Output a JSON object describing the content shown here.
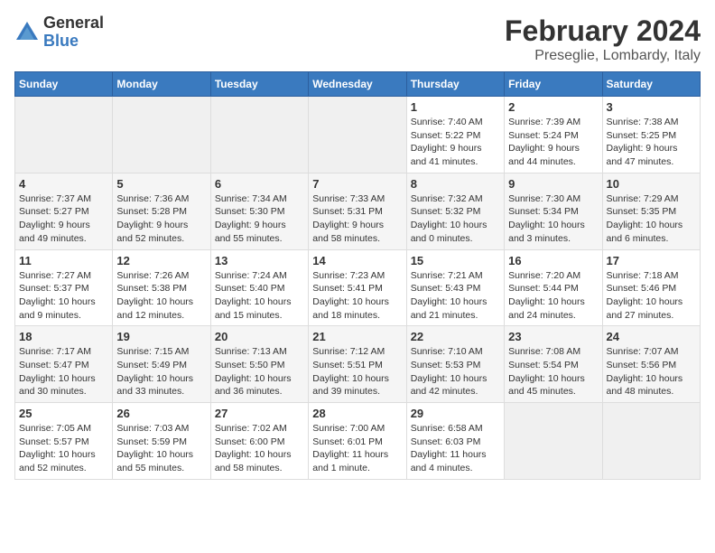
{
  "header": {
    "logo_line1": "General",
    "logo_line2": "Blue",
    "title": "February 2024",
    "subtitle": "Preseglie, Lombardy, Italy"
  },
  "days_of_week": [
    "Sunday",
    "Monday",
    "Tuesday",
    "Wednesday",
    "Thursday",
    "Friday",
    "Saturday"
  ],
  "weeks": [
    [
      {
        "day": "",
        "info": ""
      },
      {
        "day": "",
        "info": ""
      },
      {
        "day": "",
        "info": ""
      },
      {
        "day": "",
        "info": ""
      },
      {
        "day": "1",
        "info": "Sunrise: 7:40 AM\nSunset: 5:22 PM\nDaylight: 9 hours\nand 41 minutes."
      },
      {
        "day": "2",
        "info": "Sunrise: 7:39 AM\nSunset: 5:24 PM\nDaylight: 9 hours\nand 44 minutes."
      },
      {
        "day": "3",
        "info": "Sunrise: 7:38 AM\nSunset: 5:25 PM\nDaylight: 9 hours\nand 47 minutes."
      }
    ],
    [
      {
        "day": "4",
        "info": "Sunrise: 7:37 AM\nSunset: 5:27 PM\nDaylight: 9 hours\nand 49 minutes."
      },
      {
        "day": "5",
        "info": "Sunrise: 7:36 AM\nSunset: 5:28 PM\nDaylight: 9 hours\nand 52 minutes."
      },
      {
        "day": "6",
        "info": "Sunrise: 7:34 AM\nSunset: 5:30 PM\nDaylight: 9 hours\nand 55 minutes."
      },
      {
        "day": "7",
        "info": "Sunrise: 7:33 AM\nSunset: 5:31 PM\nDaylight: 9 hours\nand 58 minutes."
      },
      {
        "day": "8",
        "info": "Sunrise: 7:32 AM\nSunset: 5:32 PM\nDaylight: 10 hours\nand 0 minutes."
      },
      {
        "day": "9",
        "info": "Sunrise: 7:30 AM\nSunset: 5:34 PM\nDaylight: 10 hours\nand 3 minutes."
      },
      {
        "day": "10",
        "info": "Sunrise: 7:29 AM\nSunset: 5:35 PM\nDaylight: 10 hours\nand 6 minutes."
      }
    ],
    [
      {
        "day": "11",
        "info": "Sunrise: 7:27 AM\nSunset: 5:37 PM\nDaylight: 10 hours\nand 9 minutes."
      },
      {
        "day": "12",
        "info": "Sunrise: 7:26 AM\nSunset: 5:38 PM\nDaylight: 10 hours\nand 12 minutes."
      },
      {
        "day": "13",
        "info": "Sunrise: 7:24 AM\nSunset: 5:40 PM\nDaylight: 10 hours\nand 15 minutes."
      },
      {
        "day": "14",
        "info": "Sunrise: 7:23 AM\nSunset: 5:41 PM\nDaylight: 10 hours\nand 18 minutes."
      },
      {
        "day": "15",
        "info": "Sunrise: 7:21 AM\nSunset: 5:43 PM\nDaylight: 10 hours\nand 21 minutes."
      },
      {
        "day": "16",
        "info": "Sunrise: 7:20 AM\nSunset: 5:44 PM\nDaylight: 10 hours\nand 24 minutes."
      },
      {
        "day": "17",
        "info": "Sunrise: 7:18 AM\nSunset: 5:46 PM\nDaylight: 10 hours\nand 27 minutes."
      }
    ],
    [
      {
        "day": "18",
        "info": "Sunrise: 7:17 AM\nSunset: 5:47 PM\nDaylight: 10 hours\nand 30 minutes."
      },
      {
        "day": "19",
        "info": "Sunrise: 7:15 AM\nSunset: 5:49 PM\nDaylight: 10 hours\nand 33 minutes."
      },
      {
        "day": "20",
        "info": "Sunrise: 7:13 AM\nSunset: 5:50 PM\nDaylight: 10 hours\nand 36 minutes."
      },
      {
        "day": "21",
        "info": "Sunrise: 7:12 AM\nSunset: 5:51 PM\nDaylight: 10 hours\nand 39 minutes."
      },
      {
        "day": "22",
        "info": "Sunrise: 7:10 AM\nSunset: 5:53 PM\nDaylight: 10 hours\nand 42 minutes."
      },
      {
        "day": "23",
        "info": "Sunrise: 7:08 AM\nSunset: 5:54 PM\nDaylight: 10 hours\nand 45 minutes."
      },
      {
        "day": "24",
        "info": "Sunrise: 7:07 AM\nSunset: 5:56 PM\nDaylight: 10 hours\nand 48 minutes."
      }
    ],
    [
      {
        "day": "25",
        "info": "Sunrise: 7:05 AM\nSunset: 5:57 PM\nDaylight: 10 hours\nand 52 minutes."
      },
      {
        "day": "26",
        "info": "Sunrise: 7:03 AM\nSunset: 5:59 PM\nDaylight: 10 hours\nand 55 minutes."
      },
      {
        "day": "27",
        "info": "Sunrise: 7:02 AM\nSunset: 6:00 PM\nDaylight: 10 hours\nand 58 minutes."
      },
      {
        "day": "28",
        "info": "Sunrise: 7:00 AM\nSunset: 6:01 PM\nDaylight: 11 hours\nand 1 minute."
      },
      {
        "day": "29",
        "info": "Sunrise: 6:58 AM\nSunset: 6:03 PM\nDaylight: 11 hours\nand 4 minutes."
      },
      {
        "day": "",
        "info": ""
      },
      {
        "day": "",
        "info": ""
      }
    ]
  ]
}
